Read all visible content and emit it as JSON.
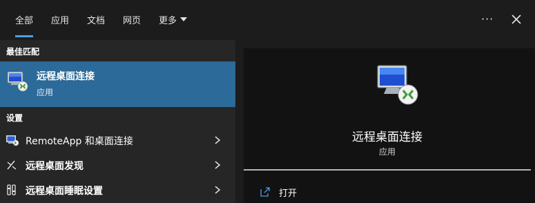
{
  "tabs": [
    {
      "label": "全部",
      "active": true
    },
    {
      "label": "应用",
      "active": false
    },
    {
      "label": "文档",
      "active": false
    },
    {
      "label": "网页",
      "active": false
    },
    {
      "label": "更多",
      "active": false
    }
  ],
  "header": {
    "more_options_icon": "ellipsis-icon",
    "close_icon": "close-icon"
  },
  "left": {
    "best_match_header": "最佳匹配",
    "best_match": {
      "title": "远程桌面连接",
      "subtitle": "应用",
      "icon": "remote-desktop-icon"
    },
    "settings_header": "设置",
    "settings_items": [
      {
        "label": "RemoteApp 和桌面连接",
        "icon": "remoteapp-icon"
      },
      {
        "label": "远程桌面发现",
        "icon": "remote-desktop-discovery-icon"
      },
      {
        "label": "远程桌面睡眠设置",
        "icon": "sleep-settings-icon"
      }
    ]
  },
  "detail": {
    "title": "远程桌面连接",
    "subtitle": "应用",
    "actions": [
      {
        "label": "打开",
        "icon": "open-icon"
      }
    ]
  },
  "colors": {
    "accent": "#4aa0e6",
    "selected_bg": "#2b6a99",
    "panel_bg": "#262626",
    "card_bg": "#121212"
  }
}
